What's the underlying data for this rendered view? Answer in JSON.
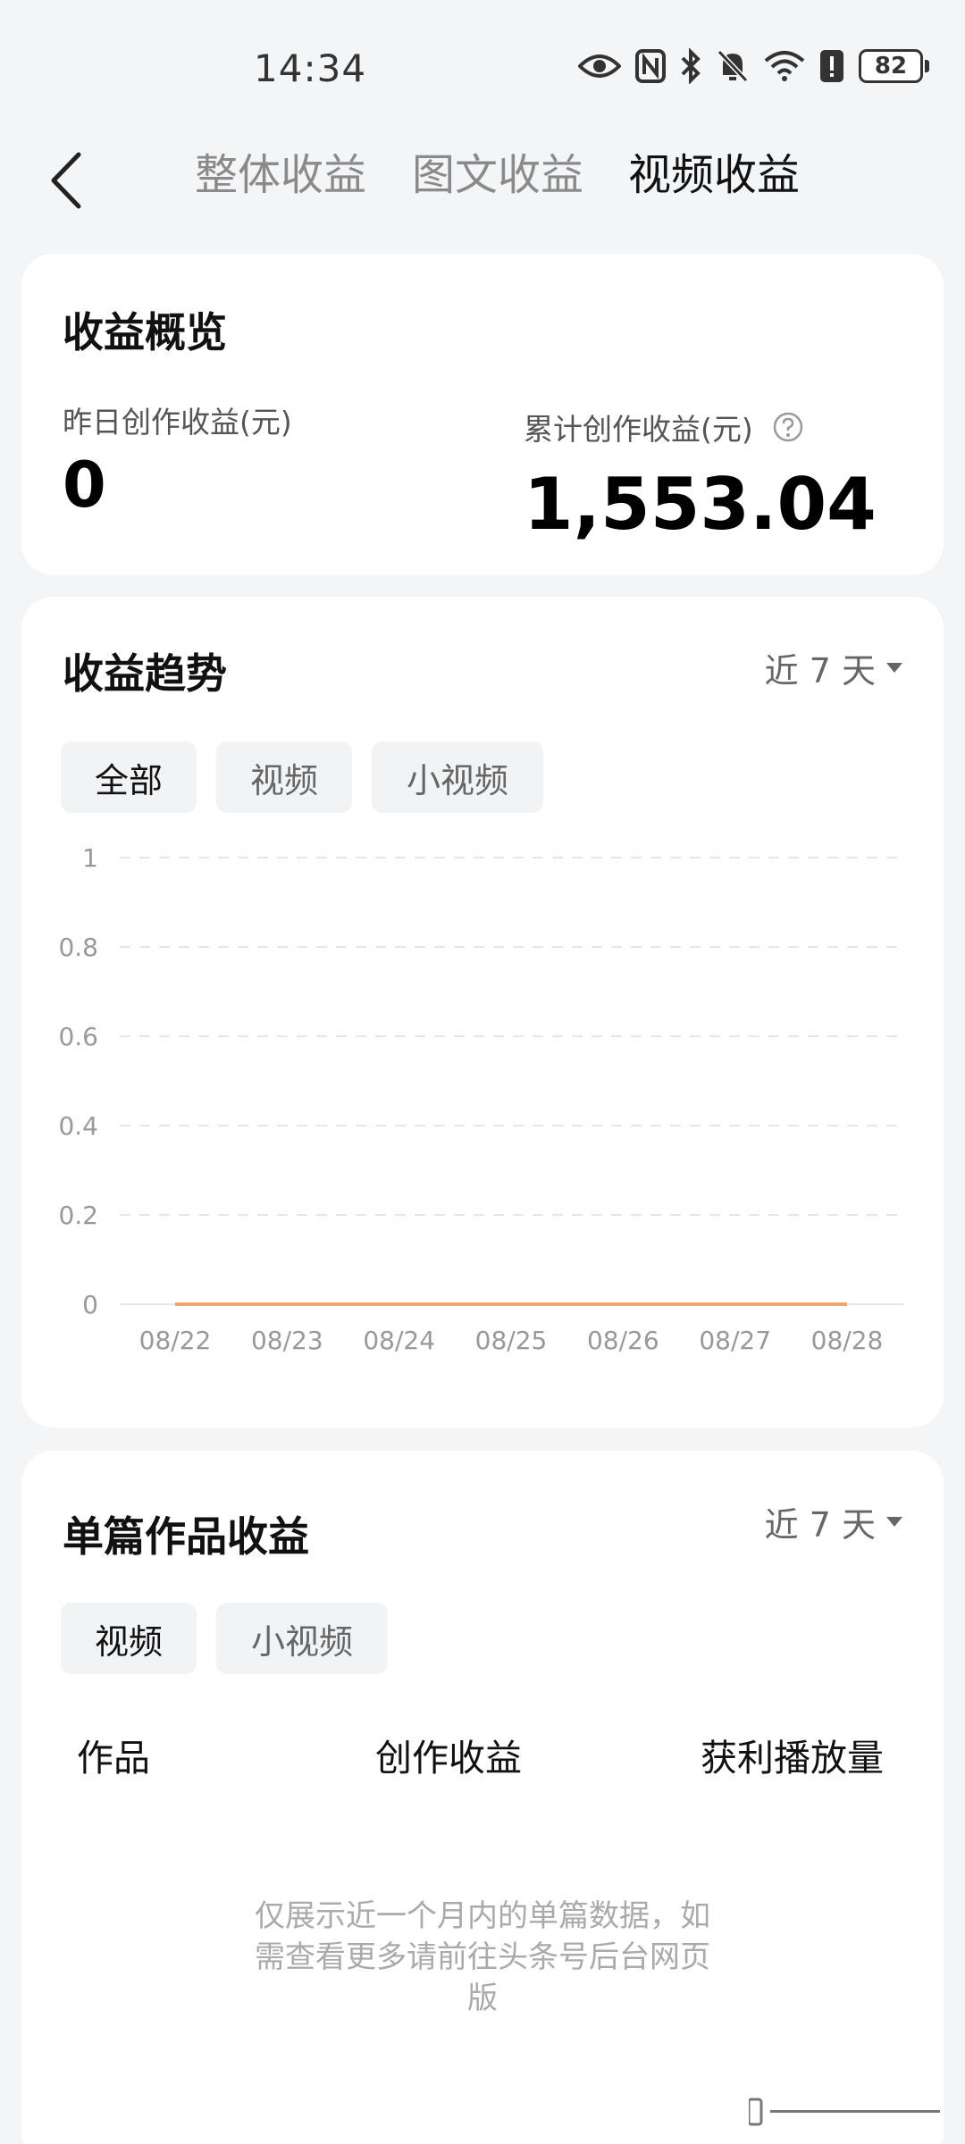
{
  "status_bar": {
    "time": "14:34",
    "battery": "82",
    "icons": [
      "eye-icon",
      "nfc-icon",
      "bluetooth-icon",
      "bell-off-icon",
      "wifi-icon",
      "alert-icon"
    ]
  },
  "nav": {
    "tabs": [
      {
        "label": "整体收益",
        "active": false
      },
      {
        "label": "图文收益",
        "active": false
      },
      {
        "label": "视频收益",
        "active": true
      }
    ]
  },
  "overview": {
    "title": "收益概览",
    "yesterday_label": "昨日创作收益(元)",
    "yesterday_value": "0",
    "total_label": "累计创作收益(元)",
    "total_value": "1,553.04"
  },
  "trend": {
    "title": "收益趋势",
    "range": "近 7 天",
    "filters": [
      {
        "label": "全部",
        "active": true
      },
      {
        "label": "视频",
        "active": false
      },
      {
        "label": "小视频",
        "active": false
      }
    ]
  },
  "chart_data": {
    "type": "line",
    "x": [
      "08/22",
      "08/23",
      "08/24",
      "08/25",
      "08/26",
      "08/27",
      "08/28"
    ],
    "series": [
      {
        "values": [
          0,
          0,
          0,
          0,
          0,
          0,
          0
        ],
        "color": "#f0a56c"
      }
    ],
    "yticks": [
      "0",
      "0.2",
      "0.4",
      "0.6",
      "0.8",
      "1"
    ],
    "ylim": [
      0,
      1
    ],
    "grid": true
  },
  "works": {
    "title": "单篇作品收益",
    "range": "近 7 天",
    "filters": [
      {
        "label": "视频",
        "active": true
      },
      {
        "label": "小视频",
        "active": false
      }
    ],
    "columns": [
      "作品",
      "创作收益",
      "获利播放量"
    ],
    "empty_note": "仅展示近一个月内的单篇数据，如需查看更多请前往头条号后台网页版"
  }
}
